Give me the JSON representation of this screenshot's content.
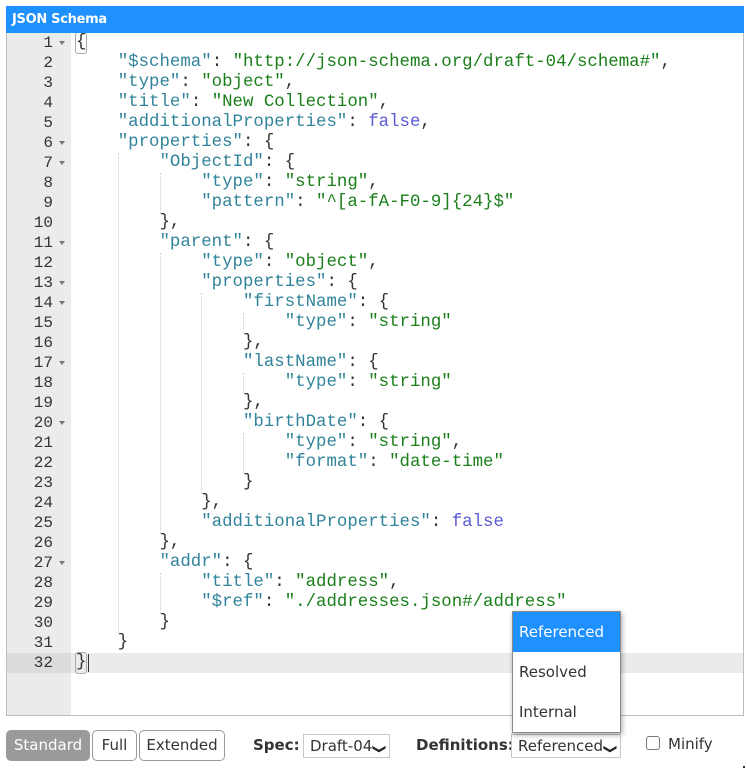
{
  "panel": {
    "title": "JSON Schema"
  },
  "editor": {
    "active_line": 32,
    "lines": [
      {
        "n": "1",
        "fold": true,
        "indent": 0,
        "tokens": [
          [
            "p",
            "{"
          ]
        ]
      },
      {
        "n": "2",
        "fold": false,
        "indent": 1,
        "tokens": [
          [
            "k",
            "\"$schema\""
          ],
          [
            "p",
            ": "
          ],
          [
            "s",
            "\"http://json-schema.org/draft-04/schema#\""
          ],
          [
            "p",
            ","
          ]
        ]
      },
      {
        "n": "3",
        "fold": false,
        "indent": 1,
        "tokens": [
          [
            "k",
            "\"type\""
          ],
          [
            "p",
            ": "
          ],
          [
            "s",
            "\"object\""
          ],
          [
            "p",
            ","
          ]
        ]
      },
      {
        "n": "4",
        "fold": false,
        "indent": 1,
        "tokens": [
          [
            "k",
            "\"title\""
          ],
          [
            "p",
            ": "
          ],
          [
            "s",
            "\"New Collection\""
          ],
          [
            "p",
            ","
          ]
        ]
      },
      {
        "n": "5",
        "fold": false,
        "indent": 1,
        "tokens": [
          [
            "k",
            "\"additionalProperties\""
          ],
          [
            "p",
            ": "
          ],
          [
            "b",
            "false"
          ],
          [
            "p",
            ","
          ]
        ]
      },
      {
        "n": "6",
        "fold": true,
        "indent": 1,
        "tokens": [
          [
            "k",
            "\"properties\""
          ],
          [
            "p",
            ": {"
          ]
        ]
      },
      {
        "n": "7",
        "fold": true,
        "indent": 2,
        "tokens": [
          [
            "k",
            "\"ObjectId\""
          ],
          [
            "p",
            ": {"
          ]
        ]
      },
      {
        "n": "8",
        "fold": false,
        "indent": 3,
        "tokens": [
          [
            "k",
            "\"type\""
          ],
          [
            "p",
            ": "
          ],
          [
            "s",
            "\"string\""
          ],
          [
            "p",
            ","
          ]
        ]
      },
      {
        "n": "9",
        "fold": false,
        "indent": 3,
        "tokens": [
          [
            "k",
            "\"pattern\""
          ],
          [
            "p",
            ": "
          ],
          [
            "s",
            "\"^[a-fA-F0-9]{24}$\""
          ]
        ]
      },
      {
        "n": "10",
        "fold": false,
        "indent": 2,
        "tokens": [
          [
            "p",
            "},"
          ]
        ]
      },
      {
        "n": "11",
        "fold": true,
        "indent": 2,
        "tokens": [
          [
            "k",
            "\"parent\""
          ],
          [
            "p",
            ": {"
          ]
        ]
      },
      {
        "n": "12",
        "fold": false,
        "indent": 3,
        "tokens": [
          [
            "k",
            "\"type\""
          ],
          [
            "p",
            ": "
          ],
          [
            "s",
            "\"object\""
          ],
          [
            "p",
            ","
          ]
        ]
      },
      {
        "n": "13",
        "fold": true,
        "indent": 3,
        "tokens": [
          [
            "k",
            "\"properties\""
          ],
          [
            "p",
            ": {"
          ]
        ]
      },
      {
        "n": "14",
        "fold": true,
        "indent": 4,
        "tokens": [
          [
            "k",
            "\"firstName\""
          ],
          [
            "p",
            ": {"
          ]
        ]
      },
      {
        "n": "15",
        "fold": false,
        "indent": 5,
        "tokens": [
          [
            "k",
            "\"type\""
          ],
          [
            "p",
            ": "
          ],
          [
            "s",
            "\"string\""
          ]
        ]
      },
      {
        "n": "16",
        "fold": false,
        "indent": 4,
        "tokens": [
          [
            "p",
            "},"
          ]
        ]
      },
      {
        "n": "17",
        "fold": true,
        "indent": 4,
        "tokens": [
          [
            "k",
            "\"lastName\""
          ],
          [
            "p",
            ": {"
          ]
        ]
      },
      {
        "n": "18",
        "fold": false,
        "indent": 5,
        "tokens": [
          [
            "k",
            "\"type\""
          ],
          [
            "p",
            ": "
          ],
          [
            "s",
            "\"string\""
          ]
        ]
      },
      {
        "n": "19",
        "fold": false,
        "indent": 4,
        "tokens": [
          [
            "p",
            "},"
          ]
        ]
      },
      {
        "n": "20",
        "fold": true,
        "indent": 4,
        "tokens": [
          [
            "k",
            "\"birthDate\""
          ],
          [
            "p",
            ": {"
          ]
        ]
      },
      {
        "n": "21",
        "fold": false,
        "indent": 5,
        "tokens": [
          [
            "k",
            "\"type\""
          ],
          [
            "p",
            ": "
          ],
          [
            "s",
            "\"string\""
          ],
          [
            "p",
            ","
          ]
        ]
      },
      {
        "n": "22",
        "fold": false,
        "indent": 5,
        "tokens": [
          [
            "k",
            "\"format\""
          ],
          [
            "p",
            ": "
          ],
          [
            "s",
            "\"date-time\""
          ]
        ]
      },
      {
        "n": "23",
        "fold": false,
        "indent": 4,
        "tokens": [
          [
            "p",
            "}"
          ]
        ]
      },
      {
        "n": "24",
        "fold": false,
        "indent": 3,
        "tokens": [
          [
            "p",
            "},"
          ]
        ]
      },
      {
        "n": "25",
        "fold": false,
        "indent": 3,
        "tokens": [
          [
            "k",
            "\"additionalProperties\""
          ],
          [
            "p",
            ": "
          ],
          [
            "b",
            "false"
          ]
        ]
      },
      {
        "n": "26",
        "fold": false,
        "indent": 2,
        "tokens": [
          [
            "p",
            "},"
          ]
        ]
      },
      {
        "n": "27",
        "fold": true,
        "indent": 2,
        "tokens": [
          [
            "k",
            "\"addr\""
          ],
          [
            "p",
            ": {"
          ]
        ]
      },
      {
        "n": "28",
        "fold": false,
        "indent": 3,
        "tokens": [
          [
            "k",
            "\"title\""
          ],
          [
            "p",
            ": "
          ],
          [
            "s",
            "\"address\""
          ],
          [
            "p",
            ","
          ]
        ]
      },
      {
        "n": "29",
        "fold": false,
        "indent": 3,
        "tokens": [
          [
            "k",
            "\"$ref\""
          ],
          [
            "p",
            ": "
          ],
          [
            "s",
            "\"./addresses.json#/address\""
          ]
        ]
      },
      {
        "n": "30",
        "fold": false,
        "indent": 2,
        "tokens": [
          [
            "p",
            "}"
          ]
        ]
      },
      {
        "n": "31",
        "fold": false,
        "indent": 1,
        "tokens": [
          [
            "p",
            "}"
          ]
        ]
      },
      {
        "n": "32",
        "fold": false,
        "indent": 0,
        "tokens": [
          [
            "p",
            "}"
          ]
        ]
      }
    ]
  },
  "footer": {
    "modes": [
      {
        "label": "Standard",
        "selected": true
      },
      {
        "label": "Full",
        "selected": false
      },
      {
        "label": "Extended",
        "selected": false
      }
    ],
    "spec_label": "Spec:",
    "spec_value": "Draft-04",
    "definitions_label": "Definitions:",
    "definitions_value": "Referenced",
    "minify_label": "Minify",
    "minify_checked": false
  },
  "definitions_dropdown": {
    "open": true,
    "options": [
      {
        "label": "Referenced",
        "highlighted": true
      },
      {
        "label": "Resolved",
        "highlighted": false
      },
      {
        "label": "Internal",
        "highlighted": false
      }
    ]
  },
  "colors": {
    "accent": "#1e90ff",
    "key": "#31849b",
    "string": "#1a7f1a",
    "boolean": "#5b5bd6",
    "selected_mode_bg": "#9a9a9a"
  }
}
